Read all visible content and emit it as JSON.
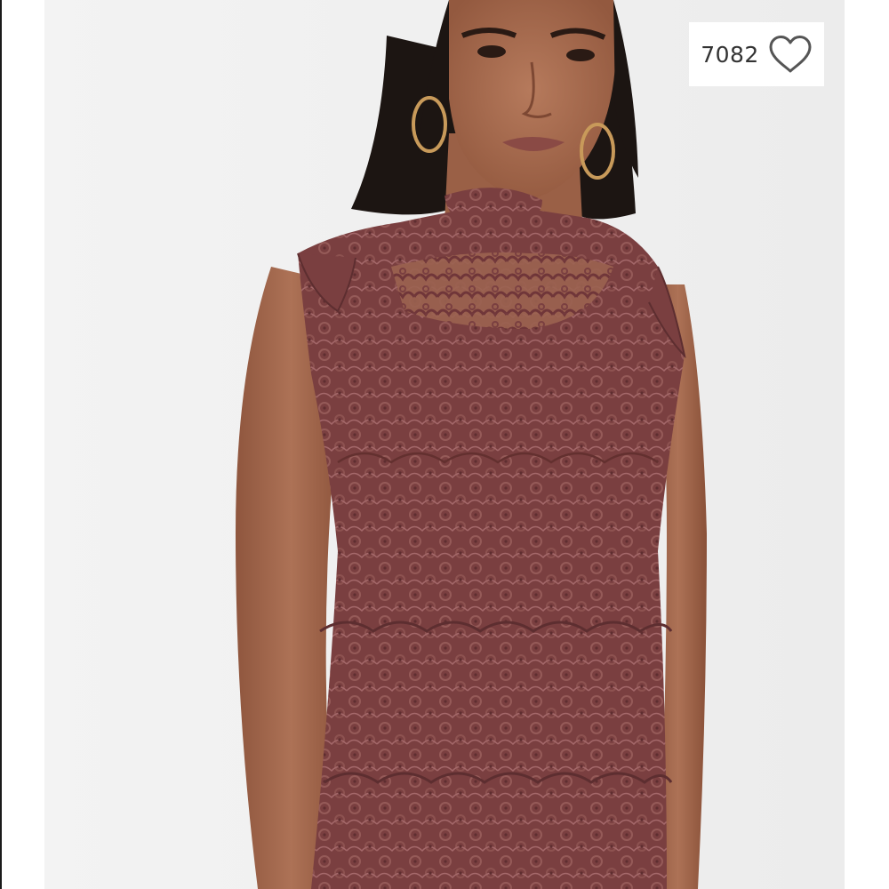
{
  "product_image": {
    "alt_subject": "lace-dress-photo",
    "background_color": "#f0f0f0",
    "dress_color": "#7a3f40",
    "skin_color": "#a86c50",
    "hair_color": "#1c1512"
  },
  "like_badge": {
    "count": "7082",
    "icon": "heart-outline-icon",
    "icon_color": "#555555"
  }
}
